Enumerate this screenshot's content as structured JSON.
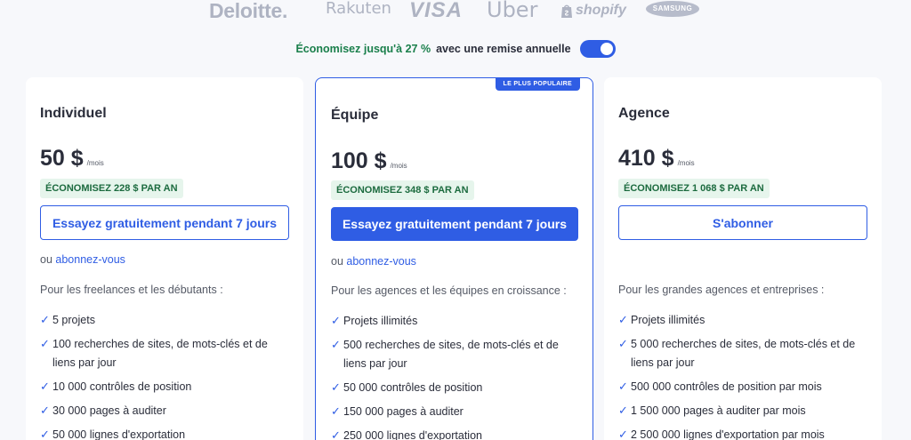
{
  "logos": {
    "deloitte": "Deloitte.",
    "rakuten": "Rakuten",
    "visa": "VISA",
    "uber": "Uber",
    "shopify": "shopify",
    "samsung": "SAMSUNG"
  },
  "billing_toggle": {
    "highlight": "Économisez jusqu'à 27 %",
    "rest": "avec une remise annuelle",
    "annual_enabled": true
  },
  "plans": [
    {
      "name": "Individuel",
      "price": "50 $",
      "per": "/mois",
      "save": "ÉCONOMISEZ 228 $ PAR AN",
      "cta": "Essayez gratuitement pendant 7 jours",
      "or_text": "ou",
      "subscribe_link": "abonnez-vous",
      "description": "Pour les freelances et les débutants :",
      "features": [
        "5 projets",
        "100 recherches de sites, de mots-clés et de liens par jour",
        "10 000 contrôles de position",
        "30 000 pages à auditer",
        "50 000 lignes d'exportation"
      ]
    },
    {
      "name": "Équipe",
      "badge": "LE PLUS POPULAIRE",
      "price": "100 $",
      "per": "/mois",
      "save": "ÉCONOMISEZ 348 $ PAR AN",
      "cta": "Essayez gratuitement pendant 7 jours",
      "or_text": "ou",
      "subscribe_link": "abonnez-vous",
      "description": "Pour les agences et les équipes en croissance :",
      "features": [
        "Projets illimités",
        "500 recherches de sites, de mots-clés et de liens par jour",
        "50 000 contrôles de position",
        "150 000 pages à auditer",
        "250 000 lignes d'exportation"
      ]
    },
    {
      "name": "Agence",
      "price": "410 $",
      "per": "/mois",
      "save": "ÉCONOMISEZ 1 068 $ PAR AN",
      "cta": "S'abonner",
      "description": "Pour les grandes agences et entreprises :",
      "features": [
        "Projets illimités",
        "5 000 recherches de sites, de mots-clés et de liens par jour",
        "500 000 contrôles de position par mois",
        "1 500 000 pages à auditer par mois",
        "2 500 000 lignes d'exportation par mois"
      ]
    }
  ],
  "check_glyph": "✓",
  "colors": {
    "accent": "#2f5de4",
    "save_bg": "#e6f5ec",
    "save_text": "#1c6b3f",
    "highlight_green": "#1a7f4b"
  }
}
